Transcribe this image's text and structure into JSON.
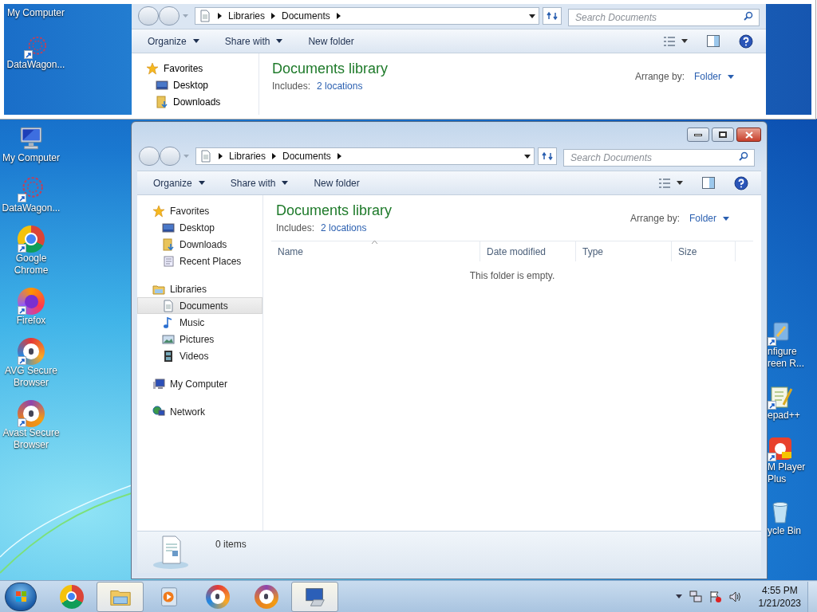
{
  "inset": {
    "desktop_icons": [
      {
        "label": "My Computer"
      },
      {
        "label": "DataWagon...",
        "kind": "datawagon"
      }
    ],
    "address": [
      "Libraries",
      "Documents"
    ],
    "search": {
      "placeholder": "Search Documents"
    },
    "toolbar": [
      {
        "label": "Organize",
        "dropdown": true
      },
      {
        "label": "Share with",
        "dropdown": true
      },
      {
        "label": "New folder",
        "dropdown": false
      }
    ],
    "nav": [
      {
        "label": "Favorites",
        "kind": "star"
      },
      {
        "label": "Desktop",
        "kind": "desktop"
      },
      {
        "label": "Downloads",
        "kind": "downloads"
      }
    ],
    "library": {
      "title": "Documents library",
      "includes_label": "Includes:",
      "includes_link": "2 locations",
      "arrange_label": "Arrange by:",
      "arrange_value": "Folder"
    }
  },
  "desktop_icons": [
    {
      "label": "My Computer",
      "kind": "computer"
    },
    {
      "label": "DataWagon...",
      "kind": "datawagon"
    },
    {
      "label": "Google Chrome",
      "kind": "chrome"
    },
    {
      "label": "Firefox",
      "kind": "firefox"
    },
    {
      "label": "AVG Secure Browser",
      "kind": "avg"
    },
    {
      "label": "Avast Secure Browser",
      "kind": "avast"
    }
  ],
  "desktop_icons_right": [
    {
      "lines": [
        "nfigure",
        "reen R..."
      ],
      "kind": "configure"
    },
    {
      "lines": [
        "epad++"
      ],
      "kind": "notepad"
    },
    {
      "lines": [
        "M Player",
        "Plus"
      ],
      "kind": "gom"
    },
    {
      "lines": [
        "ycle Bin"
      ],
      "kind": "recycle"
    }
  ],
  "window": {
    "address": [
      "Libraries",
      "Documents"
    ],
    "search": {
      "placeholder": "Search Documents"
    },
    "toolbar": [
      {
        "label": "Organize",
        "dropdown": true
      },
      {
        "label": "Share with",
        "dropdown": true
      },
      {
        "label": "New folder",
        "dropdown": false
      }
    ],
    "nav": [
      {
        "label": "Favorites",
        "kind": "star",
        "selected": false,
        "children": [
          {
            "label": "Desktop",
            "kind": "desktop",
            "selected": false
          },
          {
            "label": "Downloads",
            "kind": "downloads",
            "selected": false
          },
          {
            "label": "Recent Places",
            "kind": "recent",
            "selected": false
          }
        ]
      },
      {
        "label": "Libraries",
        "kind": "libraries",
        "selected": false,
        "children": [
          {
            "label": "Documents",
            "kind": "document",
            "selected": true
          },
          {
            "label": "Music",
            "kind": "music",
            "selected": false
          },
          {
            "label": "Pictures",
            "kind": "pictures",
            "selected": false
          },
          {
            "label": "Videos",
            "kind": "videos",
            "selected": false
          }
        ]
      },
      {
        "label": "My Computer",
        "kind": "computer",
        "selected": false
      },
      {
        "label": "Network",
        "kind": "network",
        "selected": false
      }
    ],
    "library": {
      "title": "Documents library",
      "includes_label": "Includes:",
      "includes_link": "2 locations",
      "arrange_label": "Arrange by:",
      "arrange_value": "Folder"
    },
    "columns": [
      "Name",
      "Date modified",
      "Type",
      "Size"
    ],
    "empty_message": "This folder is empty.",
    "status": "0 items"
  },
  "taskbar": {
    "apps": [
      {
        "kind": "chrome",
        "selected": false
      },
      {
        "kind": "explorer",
        "selected": true
      },
      {
        "kind": "media",
        "selected": false
      },
      {
        "kind": "avg",
        "selected": false
      },
      {
        "kind": "avast",
        "selected": false
      },
      {
        "kind": "remote",
        "selected": true
      }
    ],
    "time": "4:55 PM",
    "date": "1/21/2023"
  }
}
